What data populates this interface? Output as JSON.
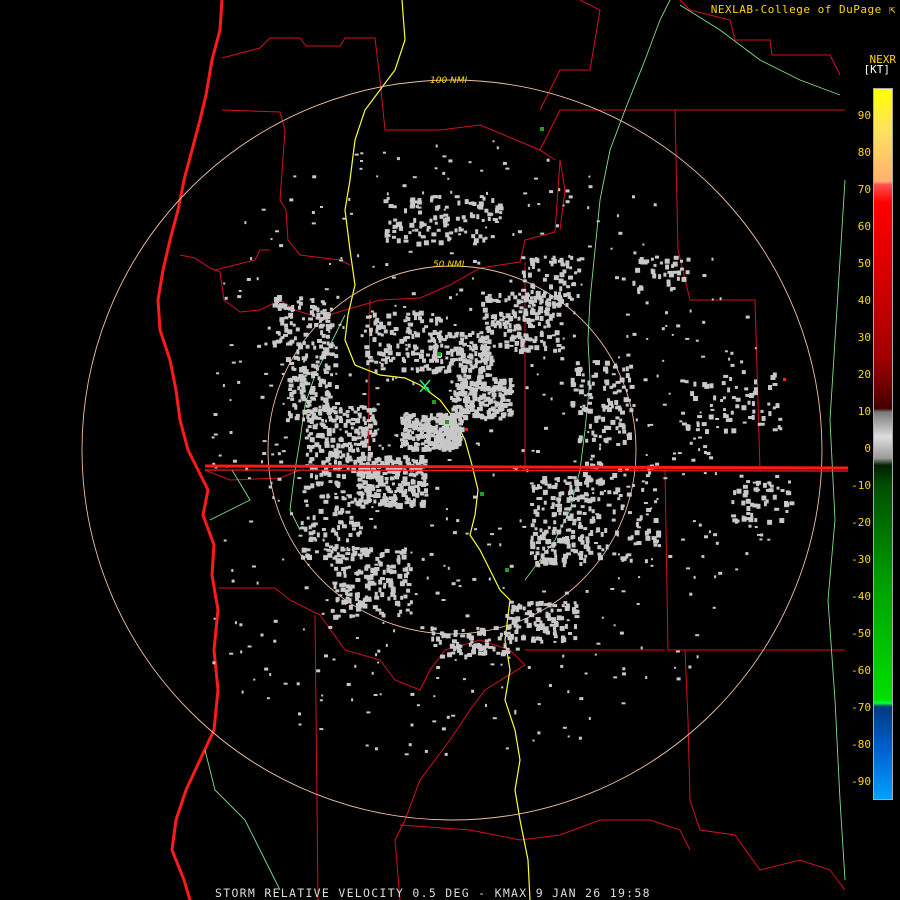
{
  "header": {
    "credit": "NEXLAB-College of DuPage",
    "credit_icon": "corner-arrow-icon",
    "product_code": "NEXR",
    "unit": "[KT]"
  },
  "footer": {
    "product_label": "STORM RELATIVE VELOCITY 0.5 DEG - KMAX 9 JAN 26 19:58"
  },
  "range_rings": [
    {
      "label": "50 NMI"
    },
    {
      "label": "100 NMI"
    }
  ],
  "legend": {
    "ticks": [
      "90",
      "80",
      "70",
      "60",
      "50",
      "40",
      "30",
      "20",
      "10",
      "0",
      "-10",
      "-20",
      "-30",
      "-40",
      "-50",
      "-60",
      "-70",
      "-80",
      "-90"
    ]
  },
  "colors": {
    "background": "#000000",
    "state_border": "#e8102a",
    "highway": "#ffff33",
    "river": "#7fe08a",
    "range_ring": "#f0c0a0",
    "label_text": "#ffd700",
    "near_zero_velocity": "#c8c8c8",
    "inbound_velocity": "#1ea01e",
    "outbound_velocity": "#ff2020"
  }
}
